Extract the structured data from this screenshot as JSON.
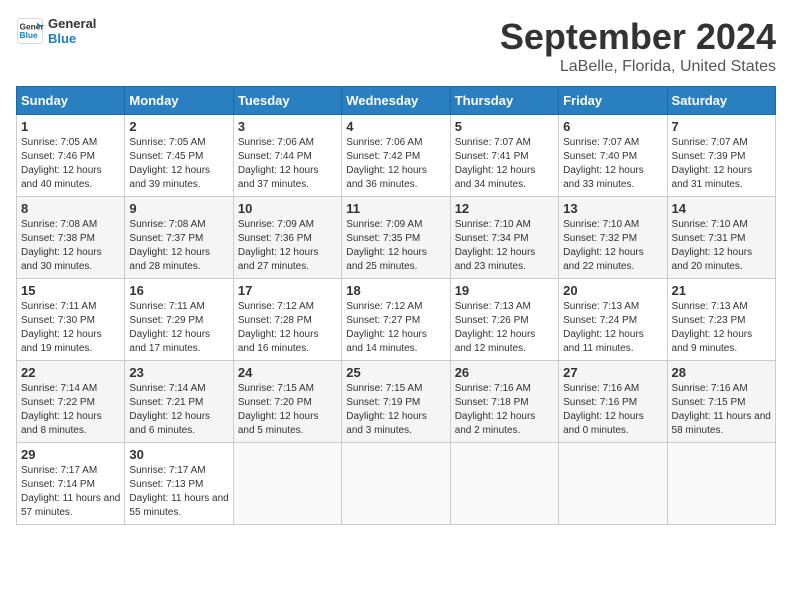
{
  "logo": {
    "line1": "General",
    "line2": "Blue"
  },
  "title": "September 2024",
  "location": "LaBelle, Florida, United States",
  "days_of_week": [
    "Sunday",
    "Monday",
    "Tuesday",
    "Wednesday",
    "Thursday",
    "Friday",
    "Saturday"
  ],
  "weeks": [
    [
      {
        "day": "1",
        "sunrise": "7:05 AM",
        "sunset": "7:46 PM",
        "daylight": "12 hours and 40 minutes."
      },
      {
        "day": "2",
        "sunrise": "7:05 AM",
        "sunset": "7:45 PM",
        "daylight": "12 hours and 39 minutes."
      },
      {
        "day": "3",
        "sunrise": "7:06 AM",
        "sunset": "7:44 PM",
        "daylight": "12 hours and 37 minutes."
      },
      {
        "day": "4",
        "sunrise": "7:06 AM",
        "sunset": "7:42 PM",
        "daylight": "12 hours and 36 minutes."
      },
      {
        "day": "5",
        "sunrise": "7:07 AM",
        "sunset": "7:41 PM",
        "daylight": "12 hours and 34 minutes."
      },
      {
        "day": "6",
        "sunrise": "7:07 AM",
        "sunset": "7:40 PM",
        "daylight": "12 hours and 33 minutes."
      },
      {
        "day": "7",
        "sunrise": "7:07 AM",
        "sunset": "7:39 PM",
        "daylight": "12 hours and 31 minutes."
      }
    ],
    [
      {
        "day": "8",
        "sunrise": "7:08 AM",
        "sunset": "7:38 PM",
        "daylight": "12 hours and 30 minutes."
      },
      {
        "day": "9",
        "sunrise": "7:08 AM",
        "sunset": "7:37 PM",
        "daylight": "12 hours and 28 minutes."
      },
      {
        "day": "10",
        "sunrise": "7:09 AM",
        "sunset": "7:36 PM",
        "daylight": "12 hours and 27 minutes."
      },
      {
        "day": "11",
        "sunrise": "7:09 AM",
        "sunset": "7:35 PM",
        "daylight": "12 hours and 25 minutes."
      },
      {
        "day": "12",
        "sunrise": "7:10 AM",
        "sunset": "7:34 PM",
        "daylight": "12 hours and 23 minutes."
      },
      {
        "day": "13",
        "sunrise": "7:10 AM",
        "sunset": "7:32 PM",
        "daylight": "12 hours and 22 minutes."
      },
      {
        "day": "14",
        "sunrise": "7:10 AM",
        "sunset": "7:31 PM",
        "daylight": "12 hours and 20 minutes."
      }
    ],
    [
      {
        "day": "15",
        "sunrise": "7:11 AM",
        "sunset": "7:30 PM",
        "daylight": "12 hours and 19 minutes."
      },
      {
        "day": "16",
        "sunrise": "7:11 AM",
        "sunset": "7:29 PM",
        "daylight": "12 hours and 17 minutes."
      },
      {
        "day": "17",
        "sunrise": "7:12 AM",
        "sunset": "7:28 PM",
        "daylight": "12 hours and 16 minutes."
      },
      {
        "day": "18",
        "sunrise": "7:12 AM",
        "sunset": "7:27 PM",
        "daylight": "12 hours and 14 minutes."
      },
      {
        "day": "19",
        "sunrise": "7:13 AM",
        "sunset": "7:26 PM",
        "daylight": "12 hours and 12 minutes."
      },
      {
        "day": "20",
        "sunrise": "7:13 AM",
        "sunset": "7:24 PM",
        "daylight": "12 hours and 11 minutes."
      },
      {
        "day": "21",
        "sunrise": "7:13 AM",
        "sunset": "7:23 PM",
        "daylight": "12 hours and 9 minutes."
      }
    ],
    [
      {
        "day": "22",
        "sunrise": "7:14 AM",
        "sunset": "7:22 PM",
        "daylight": "12 hours and 8 minutes."
      },
      {
        "day": "23",
        "sunrise": "7:14 AM",
        "sunset": "7:21 PM",
        "daylight": "12 hours and 6 minutes."
      },
      {
        "day": "24",
        "sunrise": "7:15 AM",
        "sunset": "7:20 PM",
        "daylight": "12 hours and 5 minutes."
      },
      {
        "day": "25",
        "sunrise": "7:15 AM",
        "sunset": "7:19 PM",
        "daylight": "12 hours and 3 minutes."
      },
      {
        "day": "26",
        "sunrise": "7:16 AM",
        "sunset": "7:18 PM",
        "daylight": "12 hours and 2 minutes."
      },
      {
        "day": "27",
        "sunrise": "7:16 AM",
        "sunset": "7:16 PM",
        "daylight": "12 hours and 0 minutes."
      },
      {
        "day": "28",
        "sunrise": "7:16 AM",
        "sunset": "7:15 PM",
        "daylight": "11 hours and 58 minutes."
      }
    ],
    [
      {
        "day": "29",
        "sunrise": "7:17 AM",
        "sunset": "7:14 PM",
        "daylight": "11 hours and 57 minutes."
      },
      {
        "day": "30",
        "sunrise": "7:17 AM",
        "sunset": "7:13 PM",
        "daylight": "11 hours and 55 minutes."
      },
      null,
      null,
      null,
      null,
      null
    ]
  ]
}
